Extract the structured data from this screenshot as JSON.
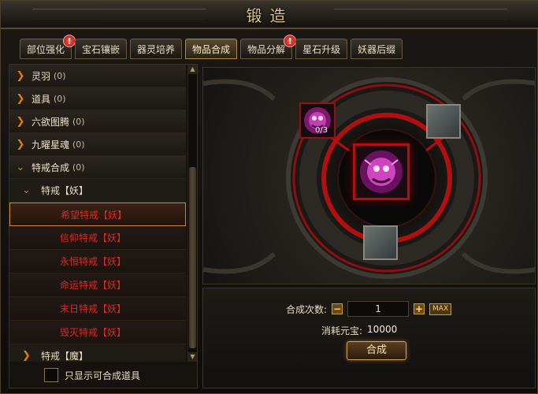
{
  "window": {
    "title": "锻造"
  },
  "tabs": [
    {
      "label": "部位强化",
      "alert": "!"
    },
    {
      "label": "宝石镶嵌"
    },
    {
      "label": "器灵培养"
    },
    {
      "label": "物品合成"
    },
    {
      "label": "物品分解",
      "alert": "!"
    },
    {
      "label": "星石升级"
    },
    {
      "label": "妖器后缀"
    }
  ],
  "tree": {
    "categories": [
      {
        "label": "灵羽",
        "count": "(0)"
      },
      {
        "label": "道具",
        "count": "(0)"
      },
      {
        "label": "六欲图腾",
        "count": "(0)"
      },
      {
        "label": "九曜星魂",
        "count": "(0)"
      },
      {
        "label": "特戒合成",
        "count": "(0)"
      }
    ],
    "group_open": "特戒【妖】",
    "leaves": [
      "希望特戒【妖】",
      "信仰特戒【妖】",
      "永恒特戒【妖】",
      "命运特戒【妖】",
      "末日特戒【妖】",
      "毁灭特戒【妖】"
    ],
    "group_closed": "特戒【魔】"
  },
  "filter": {
    "label": "只显示可合成道具"
  },
  "forge": {
    "material_count": "0/3"
  },
  "panel": {
    "qty_label": "合成次数:",
    "qty_value": "1",
    "minus": "−",
    "plus": "+",
    "max": "MAX",
    "cost_label": "消耗元宝:",
    "cost_value": "10000",
    "synth_button": "合成"
  },
  "icons": {
    "expand": "chevron-right-icon",
    "collapse": "chevron-down-icon"
  },
  "colors": {
    "accent": "#e87a14",
    "leaf_text": "#e0281e",
    "ring": "#b01010"
  }
}
